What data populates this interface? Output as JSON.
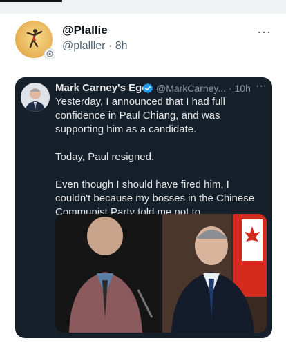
{
  "post": {
    "display_name": "@Plallie",
    "handle": "@plalller",
    "time": "8h",
    "separator": "·",
    "more_icon": "more-horizontal-icon"
  },
  "quoted_post": {
    "display_name": "Mark Carney's Ego",
    "handle": "@MarkCarney...",
    "time": "10h",
    "separator": "·",
    "verified_color": "#1d9bf0",
    "paragraphs": [
      "Yesterday, I announced that I had full confidence in Paul Chiang, and was supporting him as a candidate.",
      "Today, Paul resigned.",
      "Even though I should have fired him, I couldn't because my bosses in the Chinese Communist Party told me not to."
    ]
  },
  "colors": {
    "quote_background": "#15202b",
    "quote_text": "#e7e9ea",
    "muted": "#536471"
  }
}
